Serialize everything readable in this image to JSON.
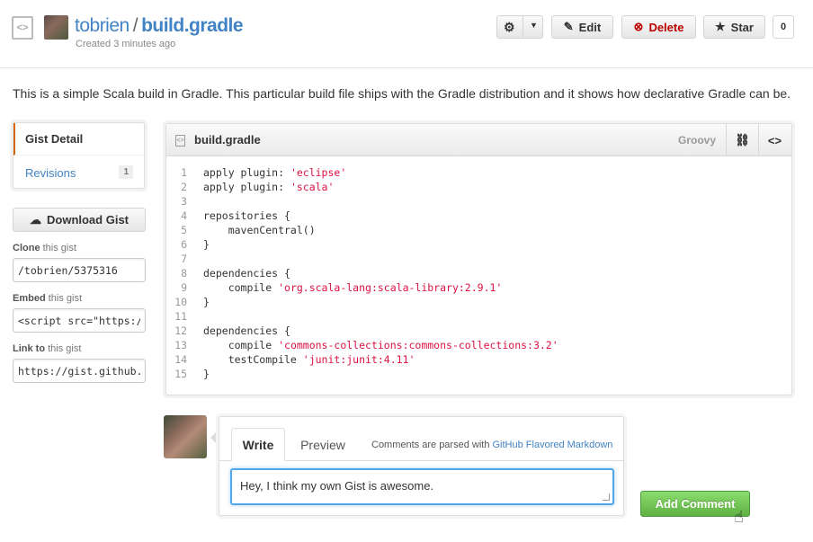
{
  "header": {
    "owner": "tobrien",
    "separator": "/",
    "gist_name": "build.gradle",
    "created": "Created 3 minutes ago",
    "buttons": {
      "edit": "Edit",
      "delete": "Delete",
      "star": "Star",
      "star_count": "0"
    }
  },
  "description": "This is a simple Scala build in Gradle. This particular build file ships with the Gradle distribution and it shows how declarative Gradle can be.",
  "sidebar": {
    "nav": {
      "detail": "Gist Detail",
      "revisions": "Revisions",
      "revisions_count": "1"
    },
    "download": "Download Gist",
    "clone": {
      "label_bold": "Clone",
      "label_rest": " this gist",
      "value": "/tobrien/5375316"
    },
    "embed": {
      "label_bold": "Embed",
      "label_rest": " this gist",
      "value": "<script src=\"https://"
    },
    "link": {
      "label_bold": "Link to",
      "label_rest": " this gist",
      "value": "https://gist.github."
    }
  },
  "file": {
    "name": "build.gradle",
    "language": "Groovy",
    "lines": [
      {
        "n": "1",
        "pre": "apply plugin: ",
        "str": "'eclipse'",
        "post": ""
      },
      {
        "n": "2",
        "pre": "apply plugin: ",
        "str": "'scala'",
        "post": ""
      },
      {
        "n": "3",
        "pre": "",
        "str": "",
        "post": ""
      },
      {
        "n": "4",
        "pre": "repositories {",
        "str": "",
        "post": ""
      },
      {
        "n": "5",
        "pre": "    mavenCentral()",
        "str": "",
        "post": ""
      },
      {
        "n": "6",
        "pre": "}",
        "str": "",
        "post": ""
      },
      {
        "n": "7",
        "pre": "",
        "str": "",
        "post": ""
      },
      {
        "n": "8",
        "pre": "dependencies {",
        "str": "",
        "post": ""
      },
      {
        "n": "9",
        "pre": "    compile ",
        "str": "'org.scala-lang:scala-library:2.9.1'",
        "post": ""
      },
      {
        "n": "10",
        "pre": "}",
        "str": "",
        "post": ""
      },
      {
        "n": "11",
        "pre": "",
        "str": "",
        "post": ""
      },
      {
        "n": "12",
        "pre": "dependencies {",
        "str": "",
        "post": ""
      },
      {
        "n": "13",
        "pre": "    compile ",
        "str": "'commons-collections:commons-collections:3.2'",
        "post": ""
      },
      {
        "n": "14",
        "pre": "    testCompile ",
        "str": "'junit:junit:4.11'",
        "post": ""
      },
      {
        "n": "15",
        "pre": "}",
        "str": "",
        "post": ""
      }
    ]
  },
  "comment": {
    "tab_write": "Write",
    "tab_preview": "Preview",
    "note_prefix": "Comments are parsed with ",
    "note_link": "GitHub Flavored Markdown",
    "text": "Hey, I think my own Gist is awesome.",
    "submit": "Add Comment"
  }
}
